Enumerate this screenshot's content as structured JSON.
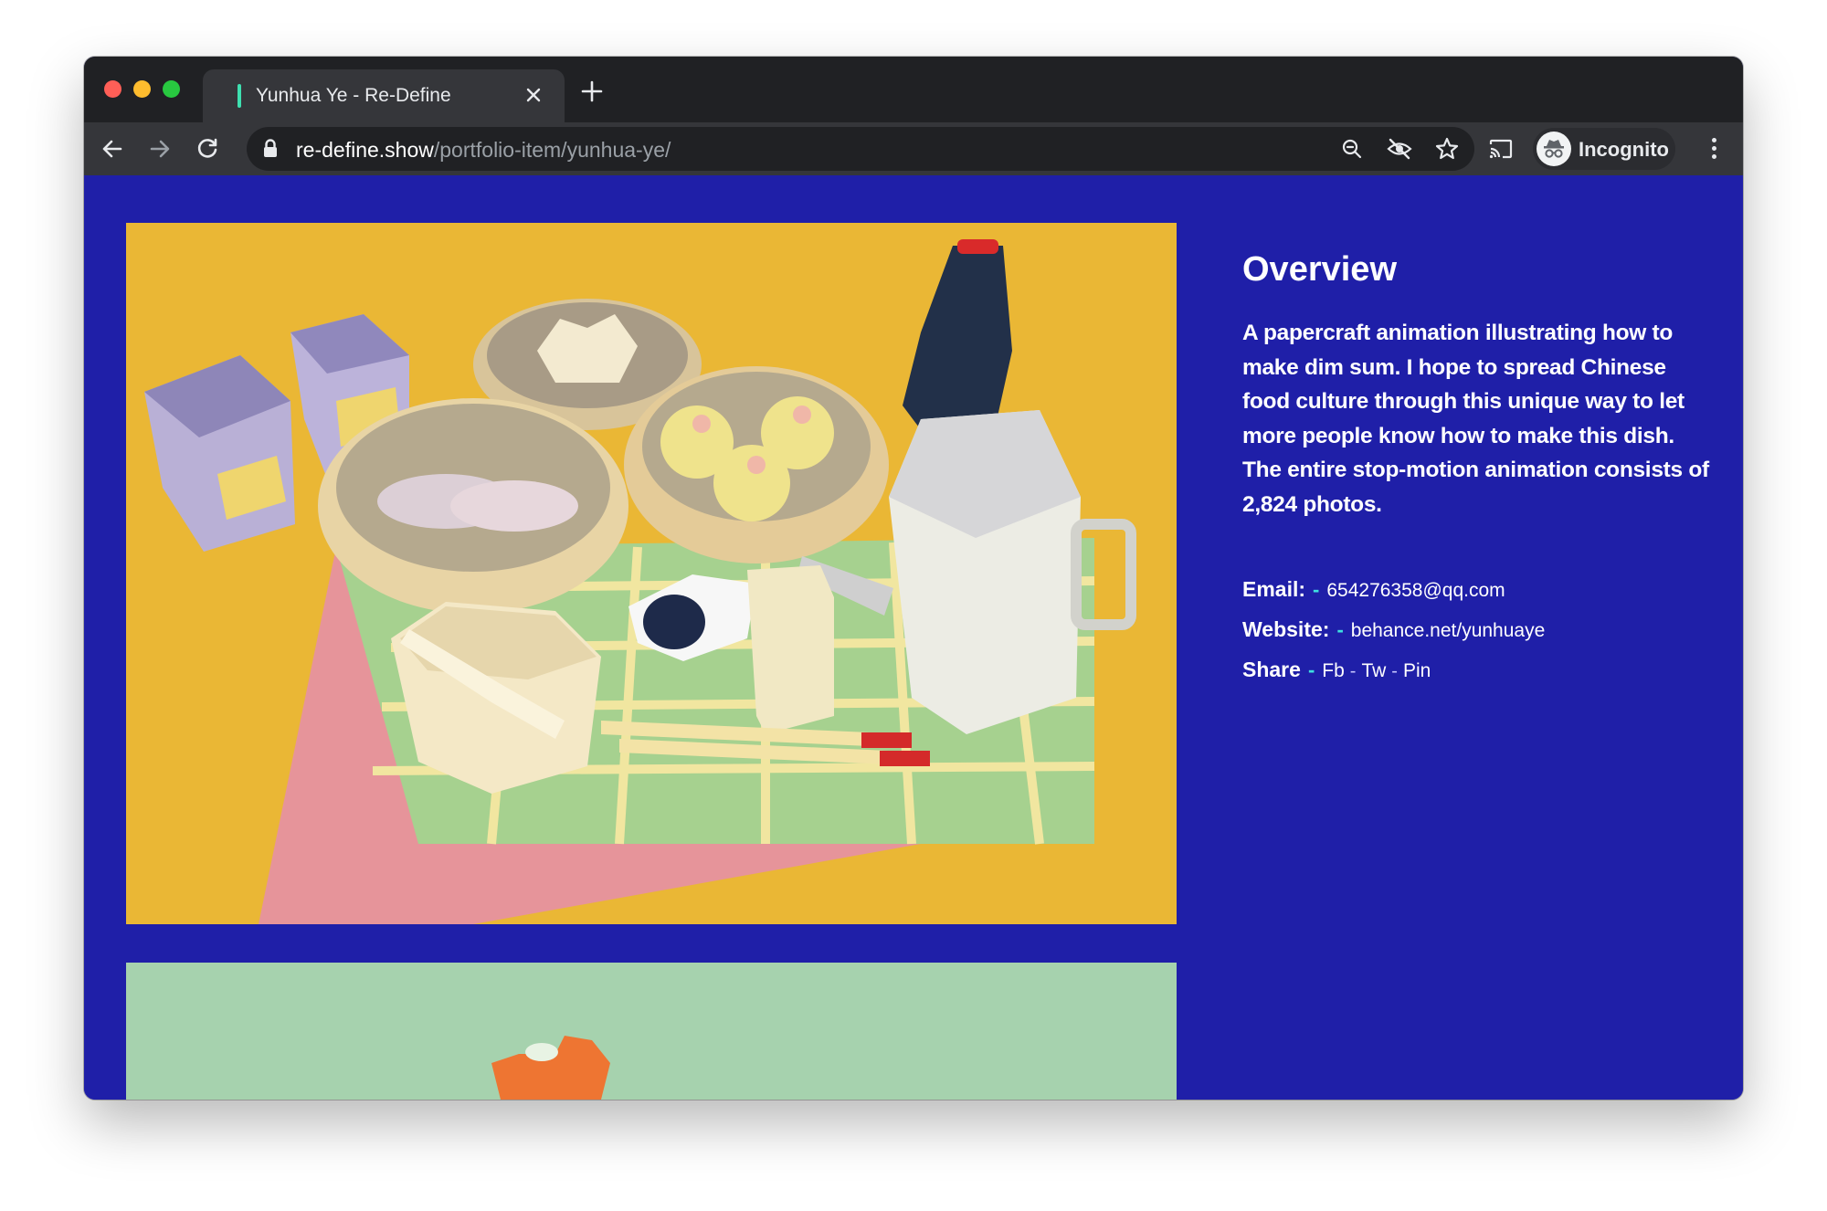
{
  "browser": {
    "tab_title": "Yunhua Ye - Re-Define",
    "url_host": "re-define.show",
    "url_path": "/portfolio-item/yunhua-ye/",
    "profile_label": "Incognito",
    "icons": [
      "back-arrow-icon",
      "forward-arrow-icon",
      "reload-icon",
      "lock-icon",
      "zoom-icon",
      "tracking-protection-icon",
      "star-icon",
      "cast-icon",
      "incognito-icon",
      "kebab-menu-icon",
      "close-icon",
      "plus-icon"
    ]
  },
  "colors": {
    "page_background": "#1f1fa8",
    "accent_dash": "#3ee0e0",
    "tab_strip": "#202124",
    "toolbar": "#35363a"
  },
  "overview": {
    "title": "Overview",
    "description": "A papercraft animation illustrating how to make dim sum. I hope to spread Chinese food culture through this unique way to let more people know how to make this dish. The entire stop-motion animation consists of 2,824 photos."
  },
  "contact": {
    "email_label": "Email:",
    "email_value": "654276358@qq.com",
    "website_label": "Website:",
    "website_value": "behance.net/yunhuaye",
    "share_label": "Share",
    "dash": "-",
    "share_links": [
      "Fb",
      "Tw",
      "Pin"
    ]
  }
}
